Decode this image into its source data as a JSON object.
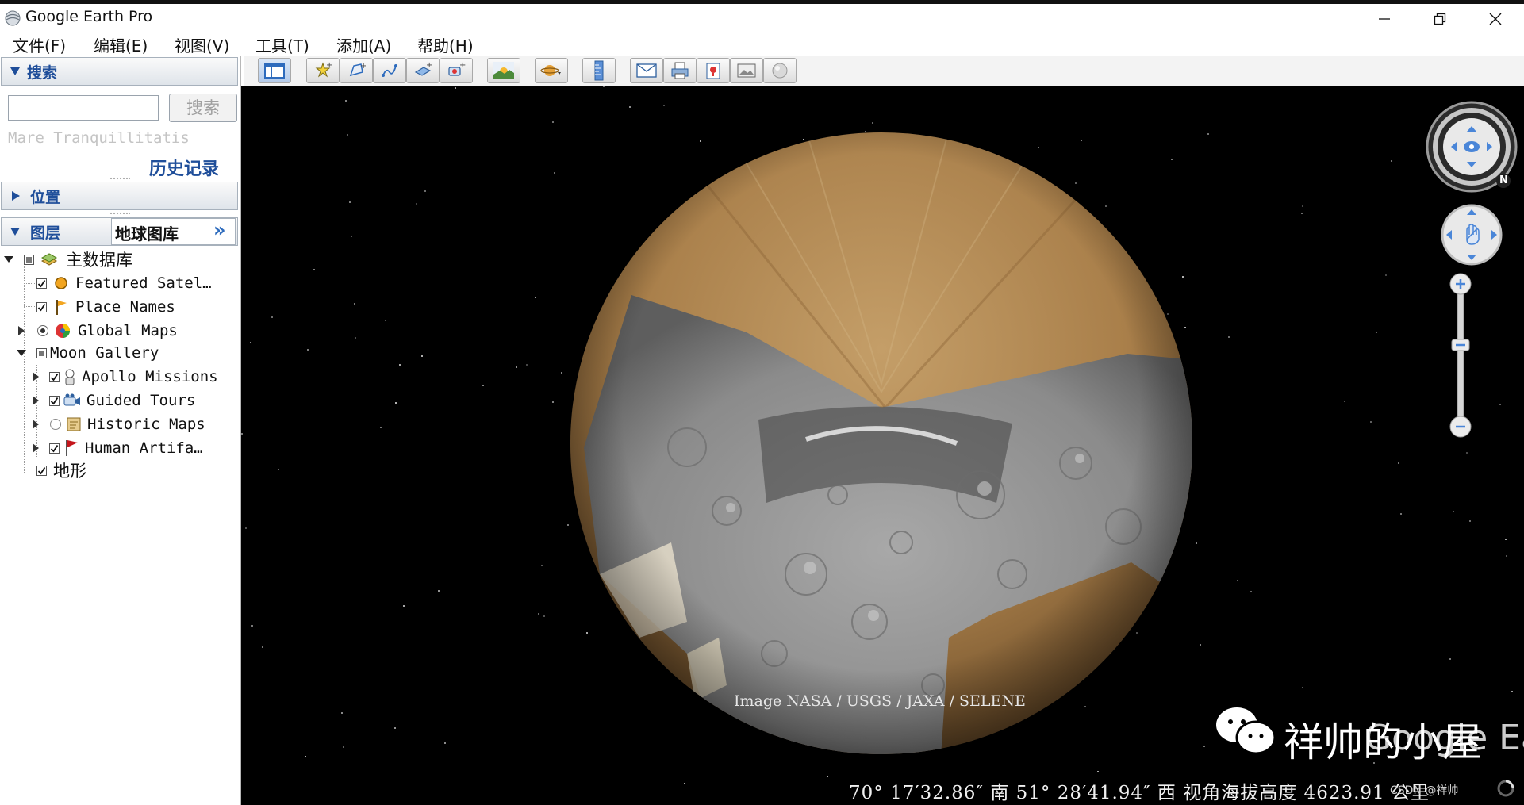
{
  "window": {
    "title": "Google Earth Pro"
  },
  "menu": [
    "文件(F)",
    "编辑(E)",
    "视图(V)",
    "工具(T)",
    "添加(A)",
    "帮助(H)"
  ],
  "toolbar": {
    "icons": [
      "sidebar-toggle-icon",
      "add-placemark-icon",
      "add-polygon-icon",
      "add-path-icon",
      "add-image-overlay-icon",
      "record-tour-icon",
      "sunlight-icon",
      "planet-switch-icon",
      "ruler-icon",
      "email-icon",
      "print-icon",
      "save-image-icon",
      "view-in-maps-icon",
      "historical-imagery-icon"
    ]
  },
  "search": {
    "header": "搜索",
    "button": "搜索",
    "input_value": "",
    "hint": "Mare Tranquillitatis",
    "history": "历史记录"
  },
  "places": {
    "header": "位置"
  },
  "layers": {
    "header": "图层",
    "gallery_tab": "地球图库",
    "more": "»",
    "items": [
      {
        "label": "主数据库"
      },
      {
        "label": "Featured Satel…"
      },
      {
        "label": "Place Names"
      },
      {
        "label": "Global Maps"
      },
      {
        "label": "Moon Gallery"
      },
      {
        "label": "Apollo Missions"
      },
      {
        "label": "Guided Tours"
      },
      {
        "label": "Historic Maps"
      },
      {
        "label": "Human Artifa…"
      },
      {
        "label": "地形"
      }
    ]
  },
  "map": {
    "credit": "Image NASA / USGS / JAXA / SELENE",
    "status": "70° 17′32.86″ 南   51° 28′41.94″ 西  视角海拔高度  4623.91 公里",
    "compass_label": "N",
    "watermark": "祥帅的小屋",
    "watermark_overlay": "Google Earth",
    "watermark_small": "CSDN @祥帅"
  },
  "colors": {
    "accent": "#1f4e9a",
    "space": "#000000",
    "moon_gray": "#9a9a9a",
    "moon_tan": "#a8814f"
  }
}
